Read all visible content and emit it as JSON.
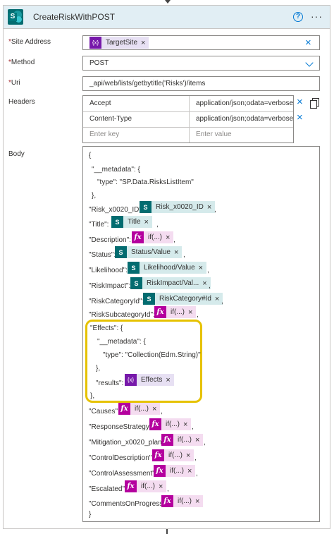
{
  "action": {
    "title": "CreateRiskWithPOST",
    "help_glyph": "?",
    "more_glyph": "···"
  },
  "site_address": {
    "label": "Site Address",
    "required_mark": "*",
    "token": {
      "kind": "variable",
      "icon": "variable-icon",
      "icon_glyph": "{x}",
      "label": "TargetSite"
    }
  },
  "method": {
    "label": "Method",
    "required_mark": "*",
    "value": "POST"
  },
  "uri": {
    "label": "Uri",
    "required_mark": "*",
    "value": "_api/web/lists/getbytitle('Risks')/items"
  },
  "headers": {
    "label": "Headers",
    "rows": [
      {
        "key": "Accept",
        "value": "application/json;odata=verbose"
      },
      {
        "key": "Content-Type",
        "value": "application/json;odata=verbose"
      }
    ],
    "key_placeholder": "Enter key",
    "value_placeholder": "Enter value"
  },
  "body": {
    "label": "Body",
    "lines": {
      "open_brace": "{",
      "metadata_key": "\"__metadata\": {",
      "type_line": "\"type\": \"SP.Data.RisksListItem\"",
      "metadata_close": "},",
      "risk_id_key": "\"Risk_x0020_ID\":",
      "title_key": "\"Title\":",
      "description_key": "\"Description\":",
      "status_key": "\"Status\":",
      "likelihood_key": "\"Likelihood\":",
      "risk_impact_key": "\"RiskImpact\":",
      "risk_category_key": "\"RiskCategoryId\":",
      "risk_subcategory_key": "\"RiskSubcategoryId\":",
      "effects_key": "\"Effects\": {",
      "effects_metadata_key": "\"__metadata\": {",
      "effects_type_line": "\"type\": \"Collection(Edm.String)\"",
      "effects_metadata_close": "},",
      "results_key": "\"results\":",
      "effects_close": "},",
      "causes_key": "\"Causes\":",
      "response_key": "\"ResponseStrategy\":",
      "mitigation_key": "\"Mitigation_x0020_plan\":",
      "control_desc_key": "\"ControlDescription\":",
      "control_assess_key": "\"ControlAssessment\":",
      "escalated_key": "\"Escalated\":",
      "comments_key": "\"CommentsOnProgress\":",
      "close_brace": "}"
    },
    "tokens": {
      "risk_id": {
        "kind": "sharepoint",
        "label": "Risk_x0020_ID"
      },
      "title": {
        "kind": "sharepoint",
        "label": "Title"
      },
      "description": {
        "kind": "expression",
        "label": "if(...)"
      },
      "status": {
        "kind": "sharepoint",
        "label": "Status/Value"
      },
      "likelihood": {
        "kind": "sharepoint",
        "label": "Likelihood/Value"
      },
      "risk_impact": {
        "kind": "sharepoint",
        "label": "RiskImpact/Val..."
      },
      "risk_category": {
        "kind": "sharepoint",
        "label": "RiskCategory#Id"
      },
      "risk_subcategory": {
        "kind": "expression",
        "label": "if(...)"
      },
      "results": {
        "kind": "variable",
        "label": "Effects"
      },
      "causes": {
        "kind": "expression",
        "label": "if(...)"
      },
      "response": {
        "kind": "expression",
        "label": "if(...)"
      },
      "mitigation": {
        "kind": "expression",
        "label": "if(...)"
      },
      "control_desc": {
        "kind": "expression",
        "label": "if(...)"
      },
      "control_assess": {
        "kind": "expression",
        "label": "if(...)"
      },
      "escalated": {
        "kind": "expression",
        "label": "if(...)"
      },
      "comments": {
        "kind": "expression",
        "label": "if(...)"
      }
    }
  },
  "glyphs": {
    "remove": "×",
    "comma": ",",
    "sp": "S",
    "fx": "fx",
    "var": "{x}"
  },
  "colors": {
    "header_bg": "#e1eef4",
    "accent": "#0078d4",
    "sharepoint": "#036c70",
    "expression": "#b4009e",
    "variable": "#7719aa",
    "highlight": "#e6c200",
    "required": "#a4262c"
  }
}
